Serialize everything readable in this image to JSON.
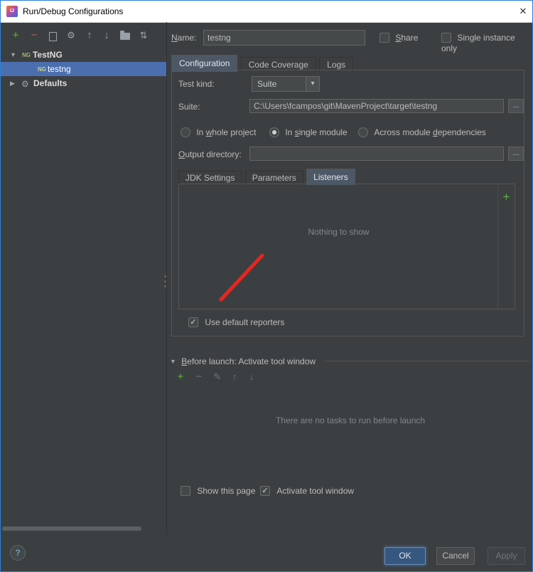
{
  "titlebar": {
    "title": "Run/Debug Configurations"
  },
  "icons": {
    "plus": "+",
    "minus": "−",
    "gear": "⚙",
    "arrow_up": "↑",
    "arrow_down": "↓",
    "sort": "⇅",
    "pencil": "✎",
    "triangle_down": "▼",
    "triangle_right": "▶",
    "combo_arrow": "▾",
    "check": "✓",
    "close": "✕",
    "help": "?",
    "ellipsis": "...",
    "testng": "NG",
    "copy": "copy-css-shape",
    "folder": "folder-css-shape"
  },
  "tree": {
    "items": [
      {
        "label": "TestNG",
        "expanded": true
      },
      {
        "label": "testng",
        "selected": true
      },
      {
        "label": "Defaults",
        "expanded": false
      }
    ]
  },
  "form": {
    "name_label": {
      "pre": "",
      "mn": "N",
      "post": "ame:"
    },
    "name_value": "testng",
    "share_label": {
      "pre": "",
      "mn": "S",
      "post": "hare"
    },
    "single_instance_label": "Single instance only",
    "tabs": [
      {
        "label": "Configuration"
      },
      {
        "label": "Code Coverage"
      },
      {
        "label": "Logs"
      }
    ],
    "test_kind_label": "Test kind:",
    "test_kind_value": "Suite",
    "suite_label": "Suite:",
    "suite_value": "C:\\Users\\fcampos\\git\\MavenProject\\target\\testng",
    "radios": [
      {
        "pre": "In ",
        "mn": "w",
        "post": "hole project",
        "selected": false
      },
      {
        "pre": "In ",
        "mn": "s",
        "post": "ingle module",
        "selected": true
      },
      {
        "pre": "Across module ",
        "mn": "d",
        "post": "ependencies",
        "selected": false
      }
    ],
    "output_label": {
      "pre": "",
      "mn": "O",
      "post": "utput directory:"
    },
    "output_value": "",
    "subtabs": [
      {
        "label": "JDK Settings"
      },
      {
        "label": "Parameters"
      },
      {
        "label": "Listeners"
      }
    ],
    "listeners_empty": "Nothing to show",
    "use_default_reporters_label": "Use default reporters",
    "use_default_reporters_checked": true
  },
  "before_launch": {
    "title": {
      "pre": "",
      "mn": "B",
      "post": "efore launch: Activate tool window"
    },
    "empty_text": "There are no tasks to run before launch",
    "show_this_page_label": "Show this page",
    "show_this_page_checked": false,
    "activate_tool_window_label": "Activate tool window",
    "activate_tool_window_checked": true
  },
  "footer": {
    "ok": "OK",
    "cancel": "Cancel",
    "apply": "Apply"
  },
  "annotation": {
    "color": "#e8261f"
  }
}
